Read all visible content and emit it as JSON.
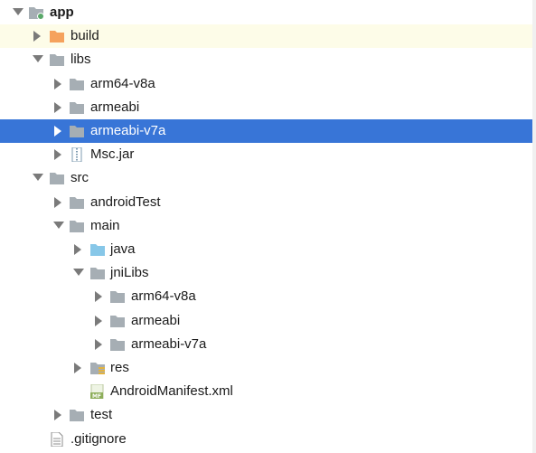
{
  "tree": {
    "items": [
      {
        "name": "app",
        "type": "module",
        "state": "expanded",
        "bold": true,
        "depth": 0
      },
      {
        "name": "build",
        "type": "folder-orange",
        "state": "collapsed",
        "depth": 1,
        "highlight": "yellow"
      },
      {
        "name": "libs",
        "type": "folder",
        "state": "expanded",
        "depth": 1
      },
      {
        "name": "arm64-v8a",
        "type": "folder",
        "state": "collapsed",
        "depth": 2
      },
      {
        "name": "armeabi",
        "type": "folder",
        "state": "collapsed",
        "depth": 2
      },
      {
        "name": "armeabi-v7a",
        "type": "folder",
        "state": "collapsed",
        "depth": 2,
        "selected": true
      },
      {
        "name": "Msc.jar",
        "type": "jar",
        "state": "collapsed",
        "depth": 2
      },
      {
        "name": "src",
        "type": "folder",
        "state": "expanded",
        "depth": 1
      },
      {
        "name": "androidTest",
        "type": "folder",
        "state": "collapsed",
        "depth": 2
      },
      {
        "name": "main",
        "type": "folder",
        "state": "expanded",
        "depth": 2
      },
      {
        "name": "java",
        "type": "folder-blue",
        "state": "collapsed",
        "depth": 3
      },
      {
        "name": "jniLibs",
        "type": "folder",
        "state": "expanded",
        "depth": 3
      },
      {
        "name": "arm64-v8a",
        "type": "folder",
        "state": "collapsed",
        "depth": 4
      },
      {
        "name": "armeabi",
        "type": "folder",
        "state": "collapsed",
        "depth": 4
      },
      {
        "name": "armeabi-v7a",
        "type": "folder",
        "state": "collapsed",
        "depth": 4
      },
      {
        "name": "res",
        "type": "folder-res",
        "state": "collapsed",
        "depth": 3
      },
      {
        "name": "AndroidManifest.xml",
        "type": "manifest",
        "state": "none",
        "depth": 3
      },
      {
        "name": "test",
        "type": "folder",
        "state": "collapsed",
        "depth": 2
      },
      {
        "name": ".gitignore",
        "type": "text-file",
        "state": "none",
        "depth": 1
      }
    ]
  },
  "colors": {
    "selection": "#3875d7",
    "hover_row": "#fdfce8",
    "folder_gray": "#a6aeb4",
    "folder_orange": "#f5a25d",
    "folder_blue": "#87c7e8",
    "arrow": "#7a7a7a",
    "selected_arrow": "#ffffff",
    "module_badge": "#59a869"
  }
}
